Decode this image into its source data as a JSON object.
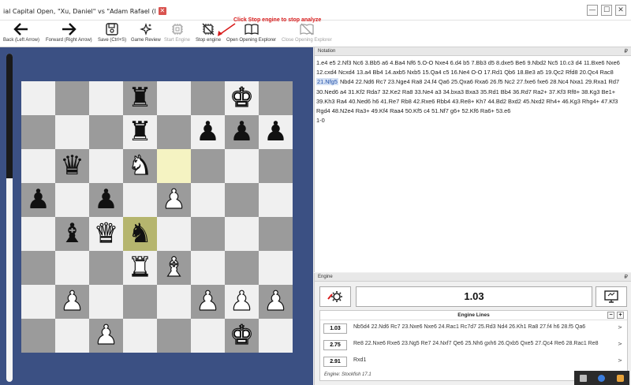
{
  "window": {
    "tab_title": "ial Capital Open, \"Xu, Daniel\" vs \"Adam Rafael (l",
    "tab_close": "✕",
    "controls": [
      "—",
      "☐",
      "✕"
    ]
  },
  "toolbar": {
    "buttons": [
      {
        "label": "Back (Left Arrow)",
        "icon": "arrow-left-icon",
        "enabled": true
      },
      {
        "label": "Forward (Right Arrow)",
        "icon": "arrow-right-icon",
        "enabled": true
      },
      {
        "label": "Save (Ctrl+S)",
        "icon": "save-icon",
        "enabled": true
      },
      {
        "label": "Game Review",
        "icon": "sparkles-icon",
        "enabled": true
      },
      {
        "label": "Start Engine",
        "icon": "cpu-icon",
        "enabled": false
      },
      {
        "label": "Stop engine",
        "icon": "cpu-off-icon",
        "enabled": true
      },
      {
        "label": "Open Opening Explorer",
        "icon": "book-icon",
        "enabled": true
      },
      {
        "label": "Close Opening Explorer",
        "icon": "book-off-icon",
        "enabled": false
      }
    ],
    "hint": "Click Stop engine to stop analyze",
    "hint_color": "#d81b1b"
  },
  "board": {
    "eval_bar_white_fraction": 0.62,
    "light_color": "#f0f0f0",
    "dark_color": "#9b9b9b",
    "highlight": [
      "e6",
      "d4"
    ],
    "position": [
      [
        "",
        "",
        "",
        "bR",
        "",
        "",
        "wK",
        ""
      ],
      [
        "",
        "",
        "",
        "bR",
        "",
        "bP",
        "bP",
        "bP"
      ],
      [
        "",
        "bQ",
        "",
        "wN",
        "",
        "",
        "",
        ""
      ],
      [
        "bP",
        "",
        "bP",
        "",
        "wP",
        "",
        "",
        ""
      ],
      [
        "",
        "bB",
        "wQ",
        "bN",
        "",
        "",
        "",
        ""
      ],
      [
        "",
        "",
        "",
        "wR",
        "wB",
        "",
        "",
        ""
      ],
      [
        "",
        "wP",
        "",
        "",
        "",
        "wP",
        "wP",
        "wP"
      ],
      [
        "",
        "",
        "wP",
        "",
        "",
        "",
        "wK",
        ""
      ]
    ]
  },
  "notation": {
    "header": "Notation",
    "pin": "₽",
    "before": "1.e4 e5 2.Nf3 Nc6 3.Bb5 a6 4.Ba4 Nf6 5.O-O Nxe4 6.d4 b5 7.Bb3 d5 8.dxe5 Be6 9.Nbd2 Nc5 10.c3 d4 11.Bxe6 Nxe6 12.cxd4 Ncxd4 13.a4 Bb4 14.axb5 Nxb5 15.Qa4 c5 16.Ne4 O-O 17.Rd1 Qb6 18.Be3 a5 19.Qc2 Rfd8 20.Qc4 Rac8 ",
    "current": "21.Nfg5",
    "after": " Nbd4 22.Nd6 Rc7 23.Nge4 Ra8 24.f4 Qa6 25.Qxa6 Rxa6 26.f5 Nc2 27.fxe6 fxe6 28.Nc4 Nxa1 29.Rxa1 Rd7 30.Ned6 a4 31.Kf2 Rda7 32.Ke2 Ra8 33.Ne4 a3 34.bxa3 Bxa3 35.Rd1 Bb4 36.Rd7 Ra2+ 37.Kf3 Rf8+ 38.Kg3 Be1+ 39.Kh3 Ra4 40.Ned6 h6 41.Re7 Rb8 42.Rxe6 Rbb4 43.Re8+ Kh7 44.Bd2 Bxd2 45.Nxd2 Rh4+ 46.Kg3 Rhg4+ 47.Kf3 Rgd4 48.N2e4 Ra3+ 49.Kf4 Raa4 50.Kf5 c4 51.Nf7 g6+ 52.Kf6 Ra6+ 53.e6",
    "result": "1-0"
  },
  "engine": {
    "header": "Engine",
    "pin": "₽",
    "evaluation": "1.03",
    "lines_title": "Engine Lines",
    "lines_minus": "−",
    "lines_plus": "+",
    "lines": [
      {
        "score": "1.03",
        "moves": "Nb5d4 22.Nd6 Rc7 23.Nxe6 Nxe6 24.Rac1 Rc7d7 25.Rd3 Nd4 26.Kh1 Ra8 27.f4 h6 28.f5 Qa6",
        "arrow": ">"
      },
      {
        "score": "2.75",
        "moves": "Re8 22.Nxe6 Rxe6 23.Ng5 Re7 24.Nxf7 Qe6 25.Nh6 gxh6 26.Qxb5 Qxe5 27.Qc4 Re6 28.Rac1 Re8",
        "arrow": ">"
      },
      {
        "score": "2.91",
        "moves": "Rxd1",
        "arrow": ">"
      }
    ],
    "engine_name": "Engine: Stockfish 17.1"
  }
}
